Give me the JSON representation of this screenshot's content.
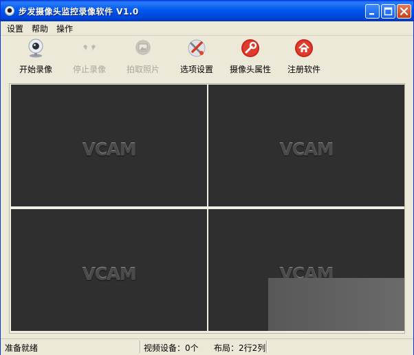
{
  "window": {
    "title": "步发摄像头监控录像软件 V1.0"
  },
  "menu": [
    {
      "label": "设置"
    },
    {
      "label": "帮助"
    },
    {
      "label": "操作"
    }
  ],
  "toolbar": {
    "start_record": "开始录像",
    "stop_record": "停止录像",
    "capture_photo": "拍取照片",
    "options": "选项设置",
    "camera_props": "摄像头属性",
    "register": "注册软件"
  },
  "video": {
    "watermark": "VCAM",
    "panes": 4
  },
  "status": {
    "ready": "准备就绪",
    "devices": "视频设备：0个",
    "layout": "布局：2行2列"
  },
  "colors": {
    "titlebar": "#0058ee",
    "chrome": "#ece9d8",
    "pane_bg": "#2f2f2f"
  }
}
